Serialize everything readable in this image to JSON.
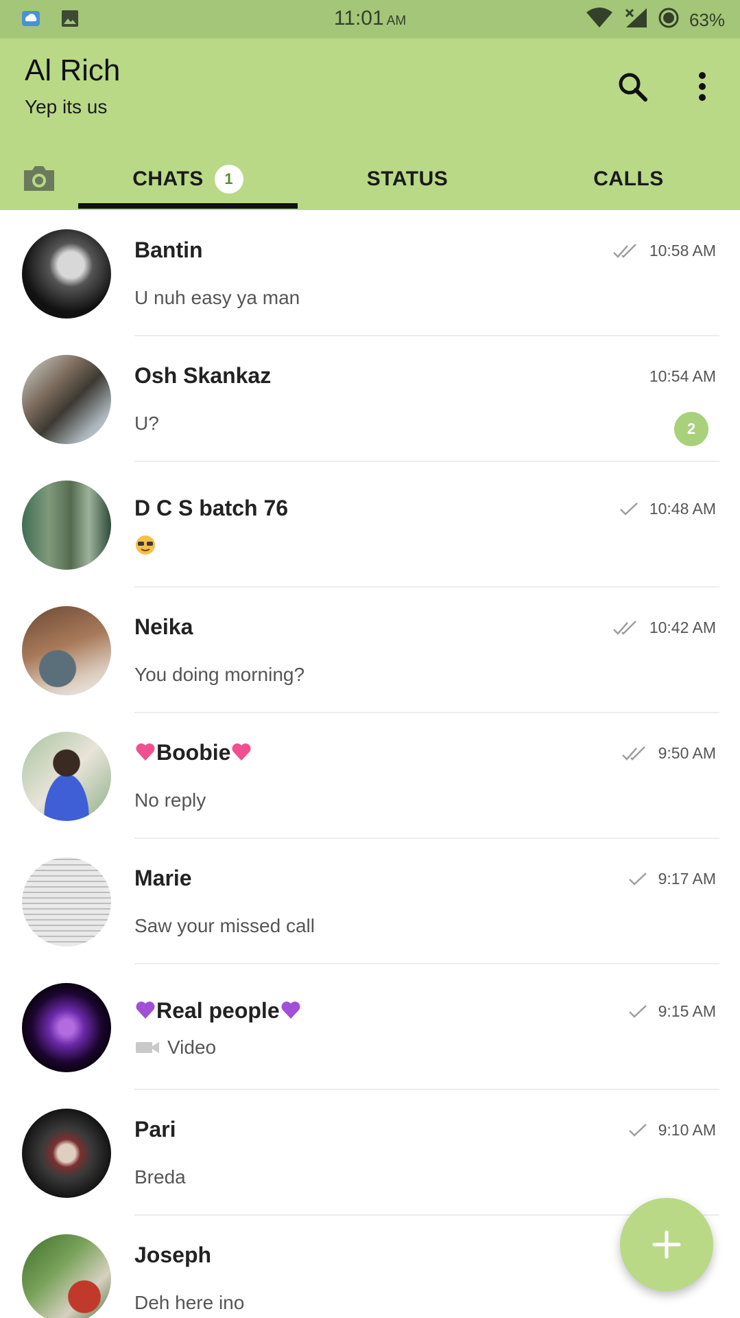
{
  "status_bar": {
    "time": "11:01",
    "ampm": "AM",
    "battery": "63%"
  },
  "header": {
    "title": "Al Rich",
    "subtitle": "Yep its us"
  },
  "tabs": {
    "camera_icon": "camera-icon",
    "chats_label": "CHATS",
    "chats_badge": "1",
    "status_label": "STATUS",
    "calls_label": "CALLS"
  },
  "chats": [
    {
      "name": "Bantin",
      "preview": "U nuh easy ya man",
      "time": "10:58 AM",
      "ticks": "double"
    },
    {
      "name": "Osh Skankaz",
      "preview": "U?",
      "time": "10:54 AM",
      "ticks": "none",
      "unread": "2"
    },
    {
      "name": " D C S batch 76",
      "preview": "",
      "time": "10:48 AM",
      "ticks": "single",
      "preview_emoji": "sunglasses-emoji"
    },
    {
      "name": "Neika",
      "preview": "You doing morning?",
      "time": "10:42 AM",
      "ticks": "double"
    },
    {
      "name": "Boobie",
      "preview": "No reply",
      "time": "9:50 AM",
      "ticks": "double",
      "name_emoji": "pink-heart-emoji"
    },
    {
      "name": "Marie",
      "preview": "Saw your missed call",
      "time": "9:17 AM",
      "ticks": "single"
    },
    {
      "name": "Real people",
      "preview": "Video",
      "time": "9:15 AM",
      "ticks": "single",
      "name_emoji": "purple-heart-emoji",
      "preview_icon": "video-icon"
    },
    {
      "name": "Pari",
      "preview": "Breda",
      "time": "9:10 AM",
      "ticks": "single"
    },
    {
      "name": "Joseph",
      "preview": "Deh here ino",
      "time": "",
      "ticks": "single"
    }
  ],
  "fab": {
    "icon": "plus-icon"
  },
  "colors": {
    "status_bar": "#a4c678",
    "app_bar": "#b9d987",
    "unread_badge": "#a9d07a"
  }
}
